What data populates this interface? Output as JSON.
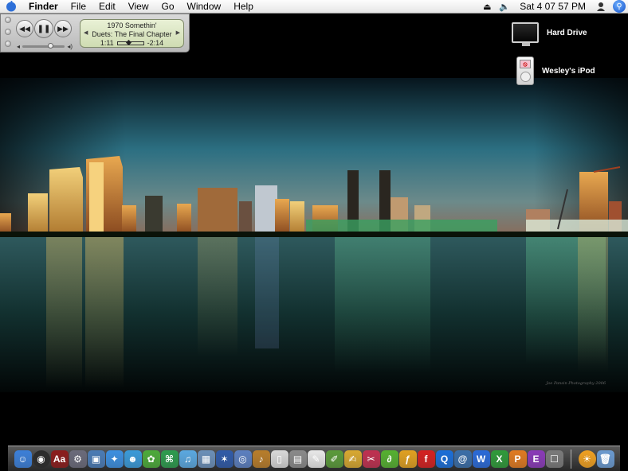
{
  "menubar": {
    "app_name": "Finder",
    "menus": [
      "File",
      "Edit",
      "View",
      "Go",
      "Window",
      "Help"
    ],
    "clock": "Sat 4 07 57 PM",
    "icons": [
      "eject-icon",
      "volume-icon",
      "user-icon",
      "spotlight-icon"
    ]
  },
  "player": {
    "line1": "1970 Somethin'",
    "line2": "Duets: The Final Chapter",
    "elapsed": "1:11",
    "remaining": "-2:14",
    "progress": 0.35,
    "volume": 0.6
  },
  "desktop_icons": [
    {
      "label": "Hard Drive",
      "icon": "hard-drive-icon"
    },
    {
      "label": "Wesley's iPod",
      "icon": "ipod-icon"
    }
  ],
  "wallpaper": {
    "signature": "Joe Pansin Photography 2006"
  },
  "dock": {
    "items": [
      {
        "name": "finder-icon",
        "color": "#3b7fd8",
        "glyph": "☺"
      },
      {
        "name": "dashboard-icon",
        "color": "#2a2a2a",
        "glyph": "◉"
      },
      {
        "name": "dictionary-icon",
        "color": "#8b1c1c",
        "glyph": "Aa"
      },
      {
        "name": "automator-icon",
        "color": "#6a6a7a",
        "glyph": "⚙"
      },
      {
        "name": "preview-icon",
        "color": "#4a7bb5",
        "glyph": "▣"
      },
      {
        "name": "safari-icon",
        "color": "#3c8fe0",
        "glyph": "✦"
      },
      {
        "name": "ichat-icon",
        "color": "#3a9ad9",
        "glyph": "☻"
      },
      {
        "name": "adium-icon",
        "color": "#4caa3a",
        "glyph": "✿"
      },
      {
        "name": "utility-icon",
        "color": "#2d9b4e",
        "glyph": "⌘"
      },
      {
        "name": "itunes-icon",
        "color": "#5aa8e0",
        "glyph": "♫"
      },
      {
        "name": "iphoto-icon",
        "color": "#6b8fb8",
        "glyph": "▦"
      },
      {
        "name": "imovie-icon",
        "color": "#2f5aa8",
        "glyph": "✶"
      },
      {
        "name": "dvd-player-icon",
        "color": "#5b7fc0",
        "glyph": "◎"
      },
      {
        "name": "garageband-icon",
        "color": "#b87d2a",
        "glyph": "♪"
      },
      {
        "name": "ipod-dock-icon",
        "color": "#d8d8d8",
        "glyph": "▯"
      },
      {
        "name": "calculator-icon",
        "color": "#8a8a8a",
        "glyph": "▤"
      },
      {
        "name": "textedit-icon",
        "color": "#e8e8e8",
        "glyph": "✎"
      },
      {
        "name": "pencil-app-icon",
        "color": "#5a9a3a",
        "glyph": "✐"
      },
      {
        "name": "paint-app-icon",
        "color": "#d8a830",
        "glyph": "✍"
      },
      {
        "name": "sketch-app-icon",
        "color": "#c03050",
        "glyph": "✂"
      },
      {
        "name": "dreamweaver-icon",
        "color": "#55b030",
        "glyph": "∂"
      },
      {
        "name": "fireworks-icon",
        "color": "#e0a020",
        "glyph": "ƒ"
      },
      {
        "name": "flash-icon",
        "color": "#d42020",
        "glyph": "f"
      },
      {
        "name": "quicktime-icon",
        "color": "#1a6ed8",
        "glyph": "Q"
      },
      {
        "name": "address-book-icon",
        "color": "#3a6ea8",
        "glyph": "@"
      },
      {
        "name": "word-icon",
        "color": "#2a6ad8",
        "glyph": "W"
      },
      {
        "name": "excel-icon",
        "color": "#2f9a3a",
        "glyph": "X"
      },
      {
        "name": "powerpoint-icon",
        "color": "#e07a20",
        "glyph": "P"
      },
      {
        "name": "entourage-icon",
        "color": "#8a3ab8",
        "glyph": "E"
      },
      {
        "name": "msn-icon",
        "color": "#7a7a7a",
        "glyph": "☐"
      },
      {
        "name": "accessibility-icon",
        "color": "#f0a020",
        "glyph": "☀"
      },
      {
        "name": "trash-icon",
        "color": "#6a9ad0",
        "glyph": "🗑"
      }
    ]
  }
}
